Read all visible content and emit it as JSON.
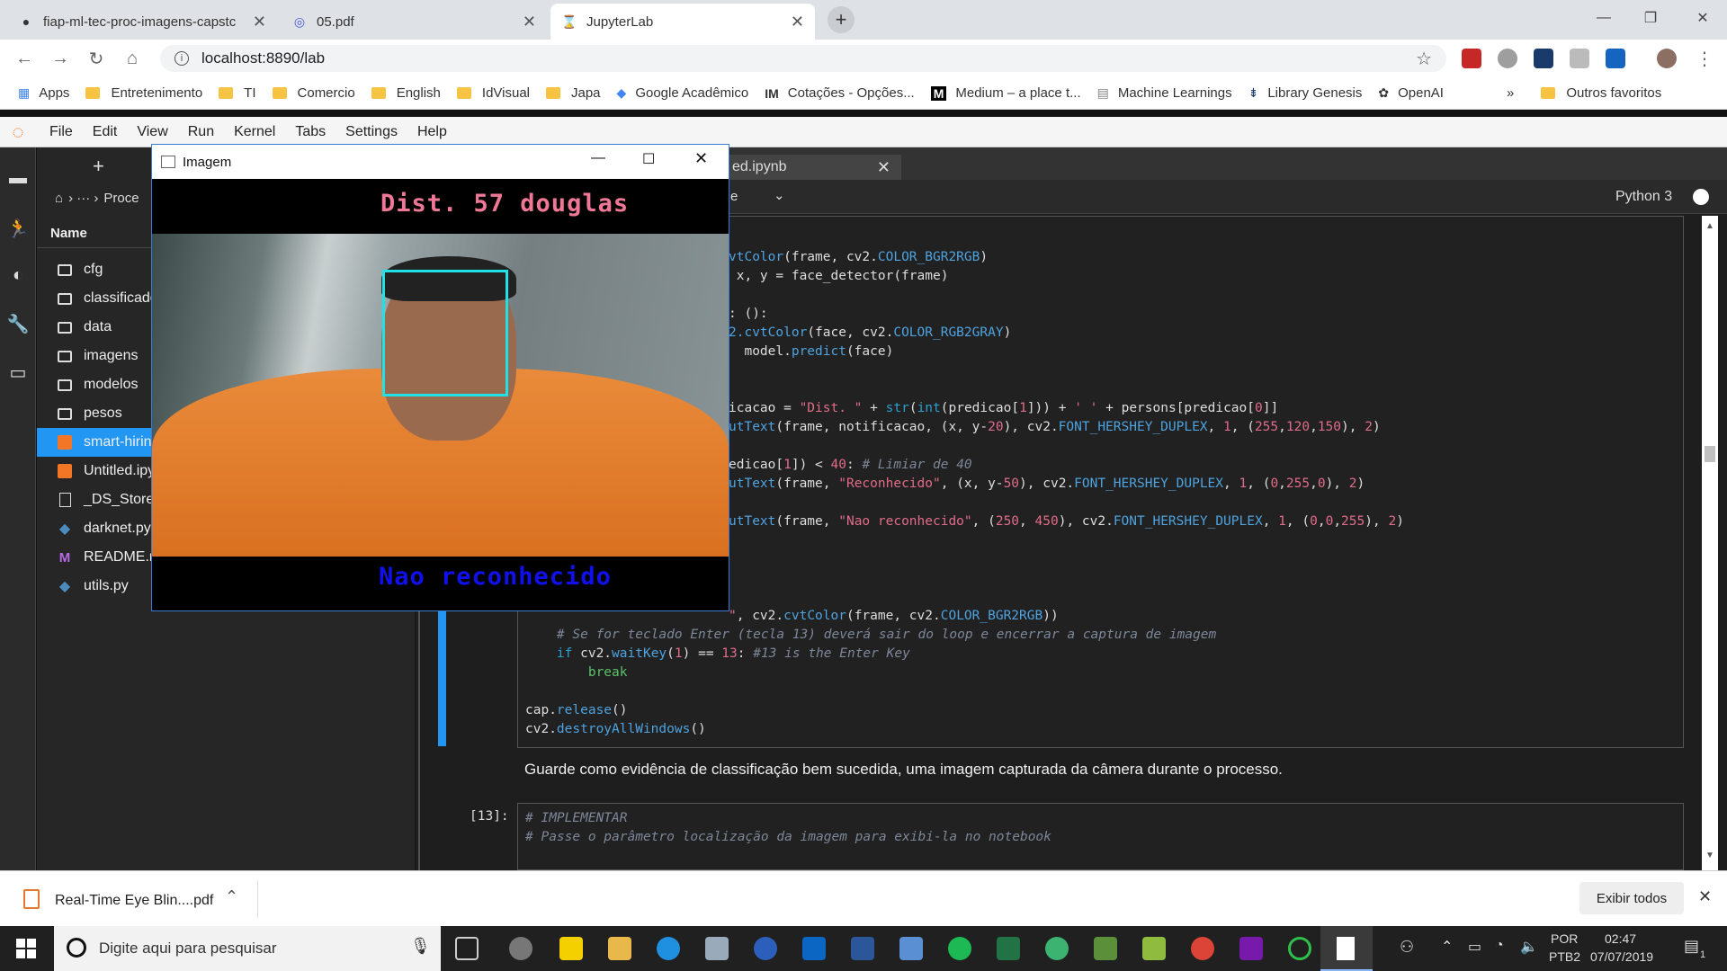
{
  "browser": {
    "tabs": [
      {
        "label": "fiap-ml-tec-proc-imagens-capstc",
        "icon": "github-icon"
      },
      {
        "label": "05.pdf",
        "icon": "pdf-icon"
      },
      {
        "label": "JupyterLab",
        "icon": "jupyter-hourglass-icon"
      }
    ],
    "url": "localhost:8890/lab",
    "bookmarks": [
      {
        "label": "Apps",
        "icon": "apps-grid-icon"
      },
      {
        "label": "Entretenimento",
        "icon": "folder-icon"
      },
      {
        "label": "TI",
        "icon": "folder-icon"
      },
      {
        "label": "Comercio",
        "icon": "folder-icon"
      },
      {
        "label": "English",
        "icon": "folder-icon"
      },
      {
        "label": "IdVisual",
        "icon": "folder-icon"
      },
      {
        "label": "Japa",
        "icon": "folder-icon"
      },
      {
        "label": "Google Acadêmico",
        "icon": "scholar-icon"
      },
      {
        "label": "Cotações - Opções...",
        "icon": "im-icon"
      },
      {
        "label": "Medium – a place t...",
        "icon": "medium-icon"
      },
      {
        "label": "Machine Learnings",
        "icon": "page-icon"
      },
      {
        "label": "Library Genesis",
        "icon": "libgen-icon"
      },
      {
        "label": "OpenAI",
        "icon": "openai-icon"
      }
    ],
    "bookmarks_overflow": "»",
    "other_bookmarks": "Outros favoritos"
  },
  "jupyter": {
    "menu": [
      "File",
      "Edit",
      "View",
      "Run",
      "Kernel",
      "Tabs",
      "Settings",
      "Help"
    ],
    "breadcrumb": "Proce",
    "file_header": "Name",
    "files": [
      {
        "name": "cfg",
        "type": "folder"
      },
      {
        "name": "classificado",
        "type": "folder"
      },
      {
        "name": "data",
        "type": "folder"
      },
      {
        "name": "imagens",
        "type": "folder"
      },
      {
        "name": "modelos",
        "type": "folder"
      },
      {
        "name": "pesos",
        "type": "folder"
      },
      {
        "name": "smart-hirin",
        "type": "notebook",
        "selected": true
      },
      {
        "name": "Untitled.ipy",
        "type": "notebook"
      },
      {
        "name": "_DS_Store",
        "type": "file"
      },
      {
        "name": "darknet.py",
        "type": "python"
      },
      {
        "name": "README.m",
        "type": "markdown"
      },
      {
        "name": "utils.py",
        "type": "python"
      }
    ],
    "notebook_tab": "ed.ipynb",
    "cell_type_fragment": "e",
    "kernel": "Python 3",
    "markdown_text": "Guarde como evidência de classificação bem sucedida, uma imagem capturada da câmera durante o processo.",
    "cell_prompt": "[13]:",
    "comment1": "# IMPLEMENTAR",
    "comment2": "# Passe o parâmetro localização da imagem para exibi-la no notebook"
  },
  "cv_window": {
    "title": "Imagem",
    "top_label": "Dist. 57 douglas",
    "bottom_label": "Nao reconhecido"
  },
  "download": {
    "file": "Real-Time Eye Blin....pdf",
    "show_all": "Exibir todos"
  },
  "taskbar": {
    "search_placeholder": "Digite aqui para pesquisar",
    "lang1": "POR",
    "lang2": "PTB2",
    "time": "02:47",
    "date": "07/07/2019",
    "notification_count": "1"
  }
}
